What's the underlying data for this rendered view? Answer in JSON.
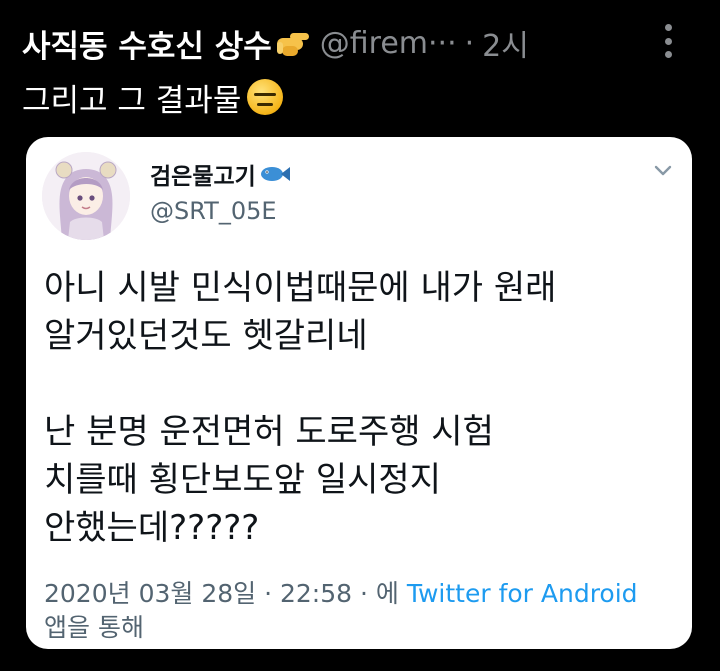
{
  "tweet": {
    "display_name": "사직동 수호신 상수",
    "handle": "@firem···",
    "separator": "·",
    "time": "2시",
    "text": "그리고 그 결과물"
  },
  "quoted": {
    "name": "검은물고기",
    "handle": "@SRT_05E",
    "body": "아니 시발 민식이법때문에 내가 원래\n알거있던것도 헷갈리네\n\n난 분명 운전면허 도로주행 시험\n치를때 횡단보도앞 일시정지\n안했는데?????",
    "date_line": "2020년 03월 28일 · 22:58 · 에 ",
    "source": "Twitter for Android",
    "via": "앱을 통해"
  },
  "icons": {
    "name_emoji": "pointing-hand-icon",
    "text_emoji": "expressionless-face-icon",
    "name_badge": "fish-icon",
    "menu": "more-vertical-icon",
    "caret": "chevron-down-icon"
  },
  "colors": {
    "background": "#000000",
    "muted_text": "#8a8d91",
    "card": "#ffffff",
    "link": "#1d9bf0"
  }
}
